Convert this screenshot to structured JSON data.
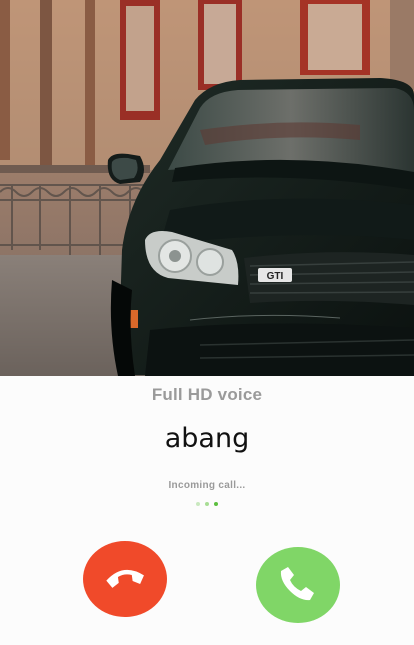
{
  "call": {
    "voice_quality": "Full HD voice",
    "caller_name": "abang",
    "status_text": "Incoming call..."
  },
  "colors": {
    "decline": "#f04a2a",
    "accept": "#80d667",
    "dot_light": "#c9e8bf",
    "dot_mid": "#a8dd95",
    "dot_active": "#5cbf3f"
  },
  "icons": {
    "decline": "phone-hangup-icon",
    "accept": "phone-icon"
  },
  "photo": {
    "badge_text": "GTI"
  }
}
